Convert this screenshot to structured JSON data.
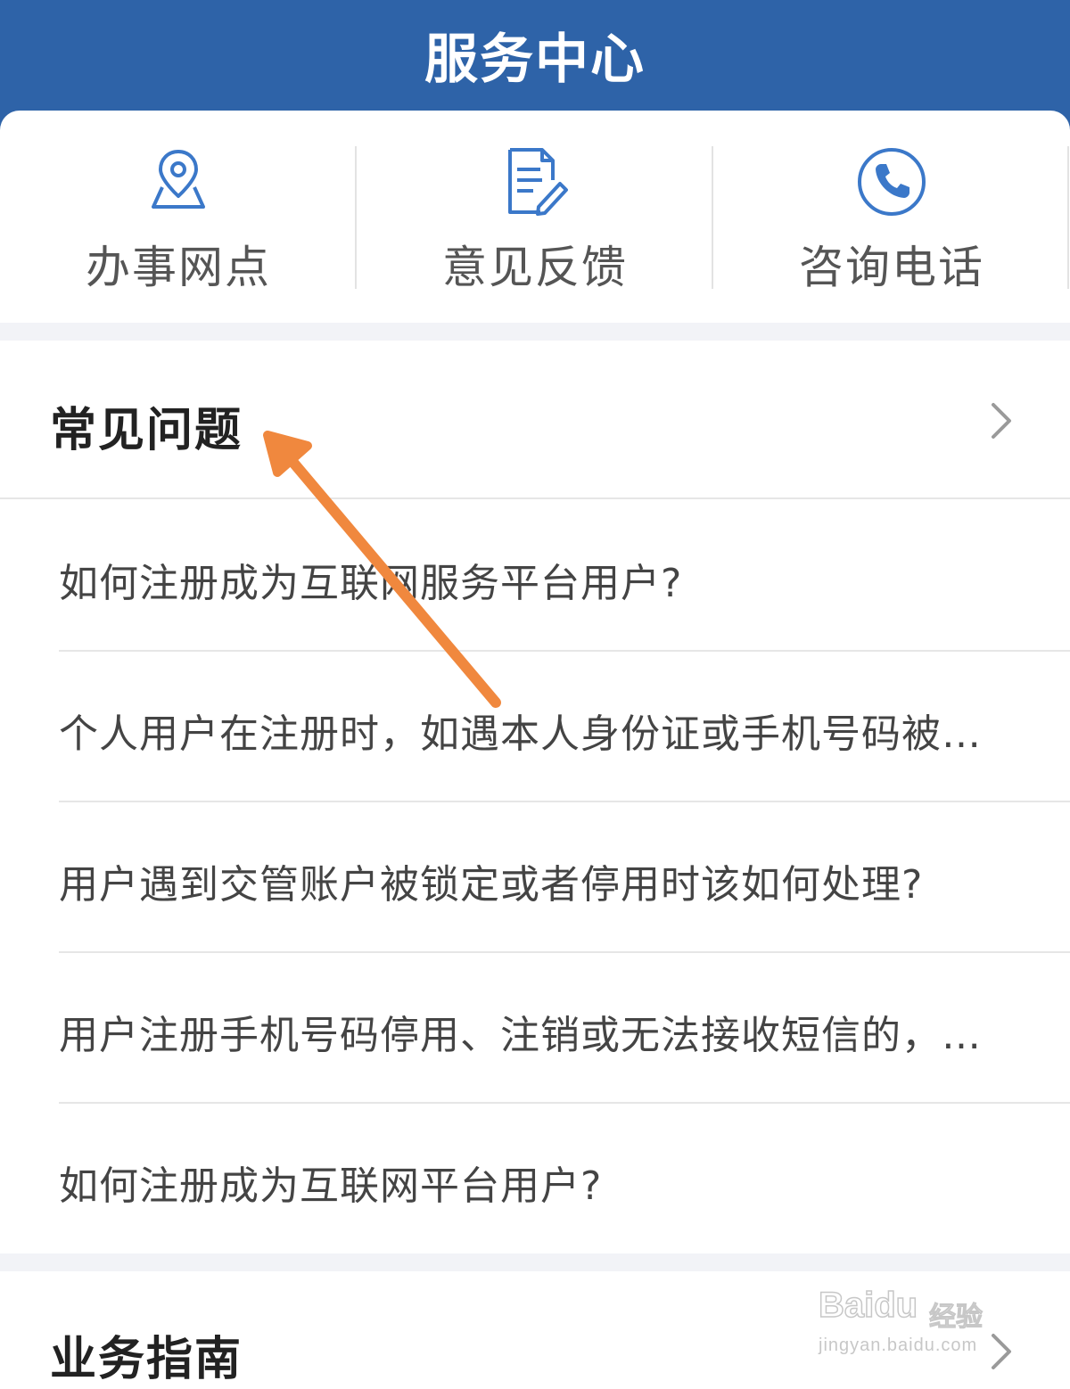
{
  "header": {
    "title": "服务中心"
  },
  "quick_links": [
    {
      "label": "办事网点",
      "icon": "location-map-icon"
    },
    {
      "label": "意见反馈",
      "icon": "feedback-document-icon"
    },
    {
      "label": "咨询电话",
      "icon": "phone-icon"
    }
  ],
  "faq": {
    "title": "常见问题",
    "items": [
      "如何注册成为互联网服务平台用户?",
      "个人用户在注册时，如遇本人身份证或手机号码被…",
      "用户遇到交管账户被锁定或者停用时该如何处理?",
      "用户注册手机号码停用、注销或无法接收短信的，…",
      "如何注册成为互联网平台用户?"
    ]
  },
  "guide": {
    "title": "业务指南"
  },
  "colors": {
    "header_bg": "#2e63a8",
    "icon_blue": "#3b78c9",
    "annotation_arrow": "#f0883e"
  },
  "watermark": {
    "brand": "Baidu",
    "sub": "经验",
    "url": "jingyan.baidu.com"
  }
}
